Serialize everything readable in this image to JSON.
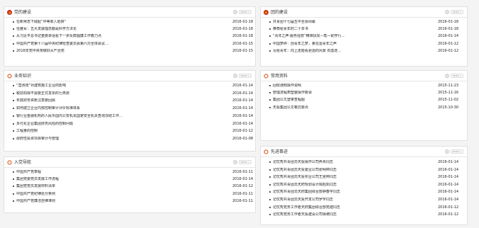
{
  "more_label": "MORE +",
  "colors": {
    "accent": "#d9531e",
    "party_icon": "#c8201b",
    "youth_icon": "#d12a1d",
    "star": "#f3c300"
  },
  "panels": [
    {
      "key": "party",
      "title": "党的建设",
      "icon": "party-emblem-icon",
      "items": [
        {
          "title": "在新常态下践起“中等收入陷阱”",
          "date": "2016-01-18"
        },
        {
          "title": "任雅军：五大发展理念都是科学方法论",
          "date": "2016-01-18"
        },
        {
          "title": "从习近平总书记重要讲话看下一步反腐倡廉工作着力点",
          "date": "2016-01-18"
        },
        {
          "title": "中国共产党第十八届中央纪律检查委员会第六次全体会议…",
          "date": "2016-01-15"
        },
        {
          "title": "2016年党中央将做好从严治党",
          "date": "2016-01-15"
        }
      ]
    },
    {
      "key": "youth",
      "title": "团的建设",
      "icon": "youth-league-emblem-icon",
      "items": [
        {
          "title": "共青团十七届五中全会闭幕",
          "date": "2016-01-18"
        },
        {
          "title": "推荐给青年的二十本书",
          "date": "2016-01-18"
        },
        {
          "title": "“青年之声·服务强技”精准扶贫—帮—助学行…",
          "date": "2016-01-14"
        },
        {
          "title": "中国梦碎：创青年之梦，量在运青年之声",
          "date": "2016-01-12"
        },
        {
          "title": "写给青年：向上走能看更远的风景 向善走…",
          "date": "2016-01-12"
        }
      ]
    },
    {
      "key": "business",
      "title": "业务知识",
      "icon": "circle-icon",
      "items": [
        {
          "title": "“营改增”对建筑施工企业的影响",
          "date": "2016-01-14"
        },
        {
          "title": "税前扣除不需要正式发票的七类费",
          "date": "2016-01-14"
        },
        {
          "title": "年底财务资账注意要回顾",
          "date": "2016-01-14"
        },
        {
          "title": "如何建立企业内部控制审计评价标准体系",
          "date": "2016-01-14"
        },
        {
          "title": "银行业金融机构的人民币国内公安机关国家安全机关查询冻结工作…",
          "date": "2016-01-14"
        },
        {
          "title": "多元化企业集团财务风险的控制问题",
          "date": "2016-01-14"
        },
        {
          "title": "工程量的控制",
          "date": "2016-01-12"
        },
        {
          "title": "政府性投资项目审计与管理",
          "date": "2016-01-08"
        }
      ]
    },
    {
      "key": "docs",
      "title": "常用资料",
      "icon": "circle-icon",
      "items": [
        {
          "title": "回收通知操作说明",
          "date": "2015-11-23"
        },
        {
          "title": "管理流程表塑整操作要诀",
          "date": "2015-11-16"
        },
        {
          "title": "集团公文登审查程图",
          "date": "2015-11-02"
        },
        {
          "title": "天投集团公文格式要点",
          "date": "2015-10-30"
        }
      ]
    },
    {
      "key": "models",
      "title": "先进事迹",
      "icon": "circle-icon",
      "items": [
        {
          "title": "记优秀共青团员天投操作公司养舟同志",
          "date": "2016-01-14"
        },
        {
          "title": "记优秀共青团员天投置业公司张明婷同志",
          "date": "2016-01-14"
        },
        {
          "title": "记优秀共青团员天投实业公司王雯婷同志",
          "date": "2016-01-14"
        },
        {
          "title": "记优秀共青团员天府规划设计院赵凯同志",
          "date": "2016-01-14"
        },
        {
          "title": "记优秀共青团员天府集团综合部钟春宇同志",
          "date": "2016-01-14"
        },
        {
          "title": "记优秀共青团员天投开发公司罗宇同志",
          "date": "2016-01-14"
        },
        {
          "title": "记优秀党务工作者天府集团综合部党建同志",
          "date": "2016-01-12"
        },
        {
          "title": "记优秀党务工作者天投建设公司徐坡同志",
          "date": "2016-01-12"
        }
      ]
    },
    {
      "key": "join",
      "title": "入党导航",
      "icon": "circle-icon",
      "items": [
        {
          "title": "中国共产党章程",
          "date": "2016-01-11"
        },
        {
          "title": "集团党委党员发展工作流程",
          "date": "2016-01-14"
        },
        {
          "title": "集团党党员发展材料清单",
          "date": "2016-01-12"
        },
        {
          "title": "中国共产党纪律处分条例",
          "date": "2016-01-11"
        },
        {
          "title": "中国共产党廉洁自律准则",
          "date": "2016-01-11"
        }
      ]
    }
  ]
}
